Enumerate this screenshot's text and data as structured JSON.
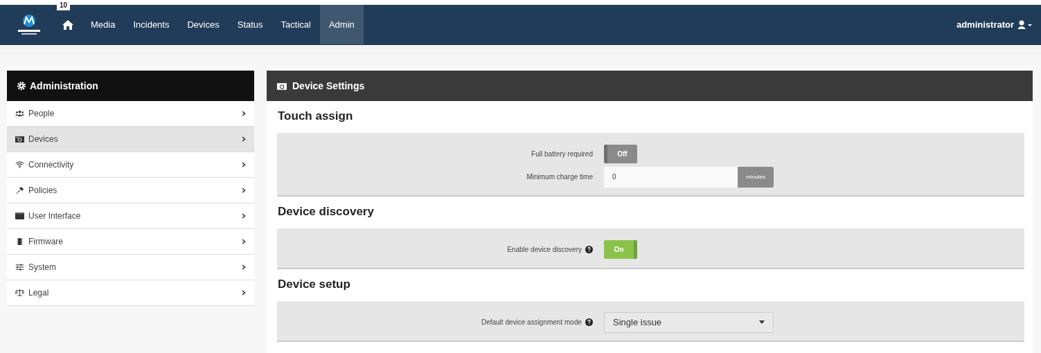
{
  "navbar": {
    "badge": "10",
    "items": [
      {
        "label": "Media",
        "selected": false
      },
      {
        "label": "Incidents",
        "selected": false
      },
      {
        "label": "Devices",
        "selected": false
      },
      {
        "label": "Status",
        "selected": false
      },
      {
        "label": "Tactical",
        "selected": false
      },
      {
        "label": "Admin",
        "selected": true
      }
    ],
    "user": "administrator"
  },
  "sidebar": {
    "title": "Administration",
    "items": [
      {
        "label": "People",
        "selected": false
      },
      {
        "label": "Devices",
        "selected": true
      },
      {
        "label": "Connectivity",
        "selected": false
      },
      {
        "label": "Policies",
        "selected": false
      },
      {
        "label": "User Interface",
        "selected": false
      },
      {
        "label": "Firmware",
        "selected": false
      },
      {
        "label": "System",
        "selected": false
      },
      {
        "label": "Legal",
        "selected": false
      }
    ]
  },
  "panel": {
    "title": "Device Settings",
    "sections": [
      {
        "heading": "Touch assign",
        "settings": [
          {
            "kind": "toggle",
            "label": "Full battery required",
            "help": false,
            "on": false,
            "text": "Off"
          },
          {
            "kind": "input",
            "label": "Minimum charge time",
            "help": false,
            "value": "0",
            "addon": "minutes"
          }
        ]
      },
      {
        "heading": "Device discovery",
        "settings": [
          {
            "kind": "toggle",
            "label": "Enable device discovery",
            "help": true,
            "on": true,
            "text": "On"
          }
        ]
      },
      {
        "heading": "Device setup",
        "settings": [
          {
            "kind": "select",
            "label": "Default device assignment mode",
            "help": true,
            "value": "Single issue"
          }
        ]
      }
    ]
  }
}
